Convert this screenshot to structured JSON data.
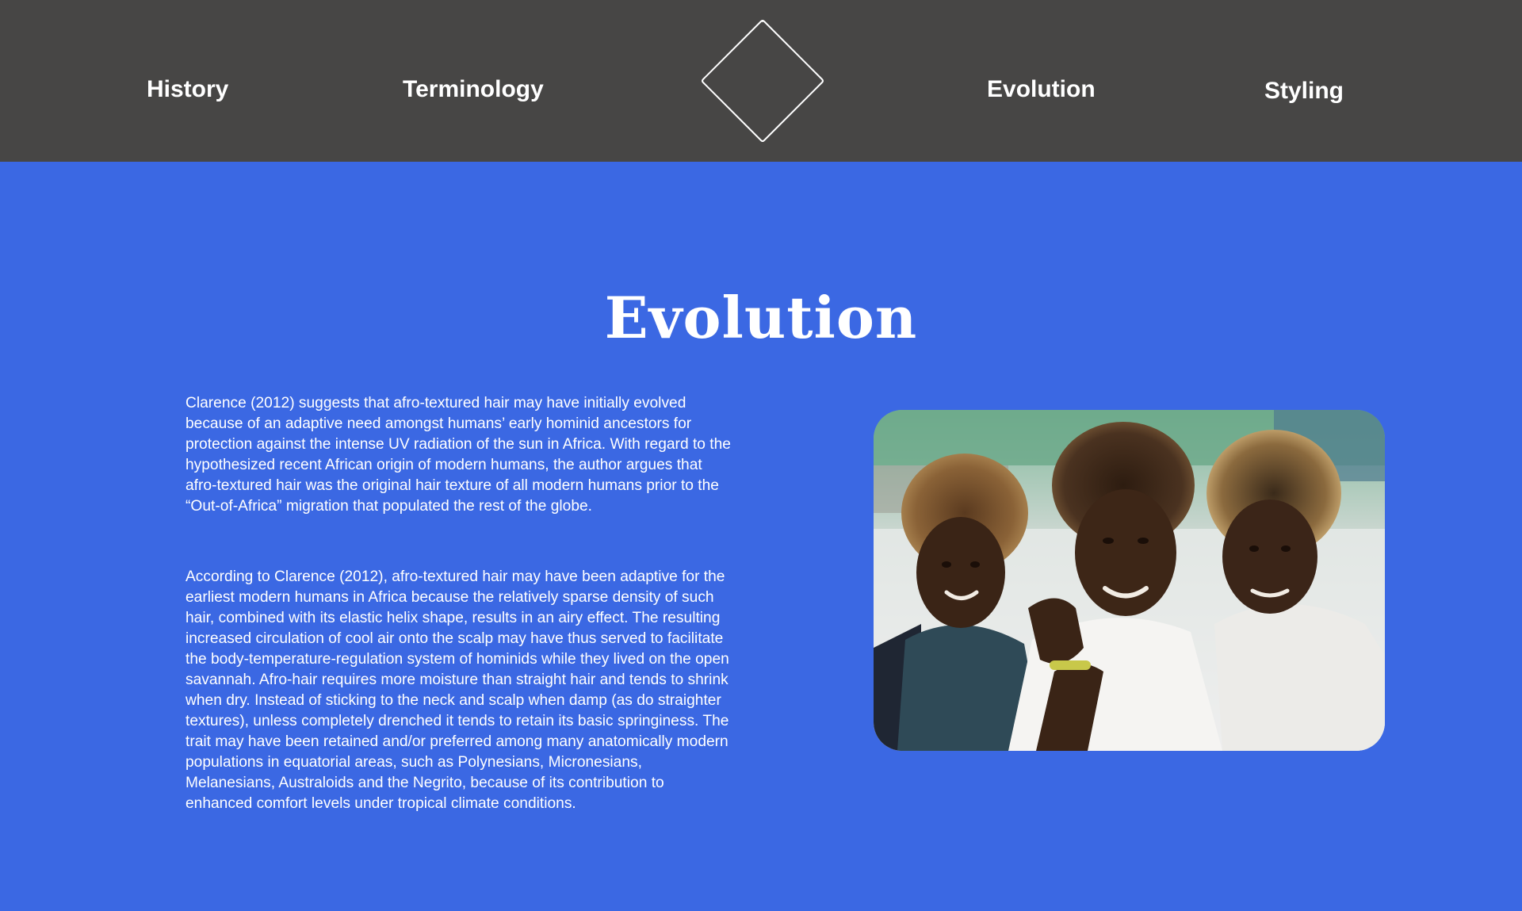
{
  "nav": {
    "left": [
      {
        "label": "History"
      },
      {
        "label": "Terminology"
      }
    ],
    "right": [
      {
        "label": "Evolution"
      },
      {
        "label": "Styling"
      }
    ],
    "logo_icon": "diamond-outline-icon"
  },
  "colors": {
    "header_bg": "#474645",
    "page_bg": "#3b68e3",
    "text": "#ffffff"
  },
  "main": {
    "title": "Evolution",
    "paragraphs": [
      "Clarence (2012) suggests that afro-textured hair may have initially evolved because of an adaptive need amongst humans’ early hominid ancestors for protection against the intense UV radiation of the sun in Africa. With regard to the hypothesized recent African origin of modern humans, the author argues that afro-textured hair was the original hair texture of all modern humans prior to the “Out-of-Africa” migration that populated the rest of the globe.",
      "According to Clarence (2012), afro-textured hair may have been adaptive for the earliest modern humans in Africa because the relatively sparse density of such hair, combined with its elastic helix shape, results in an airy effect. The resulting increased circulation of cool air onto the scalp may have thus served to facilitate the body-temperature-regulation system of hominids while they lived on the open savannah. Afro-hair requires more moisture than straight hair and tends to shrink when dry. Instead of sticking to the neck and scalp when damp (as do straighter textures), unless completely drenched it tends to retain its basic springiness. The trait may have been retained and/or preferred among many anatomically modern populations in equatorial areas, such as Polynesians, Micronesians, Melanesians, Australoids and the Negrito, because of its contribution to enhanced comfort levels under tropical climate conditions."
    ]
  }
}
